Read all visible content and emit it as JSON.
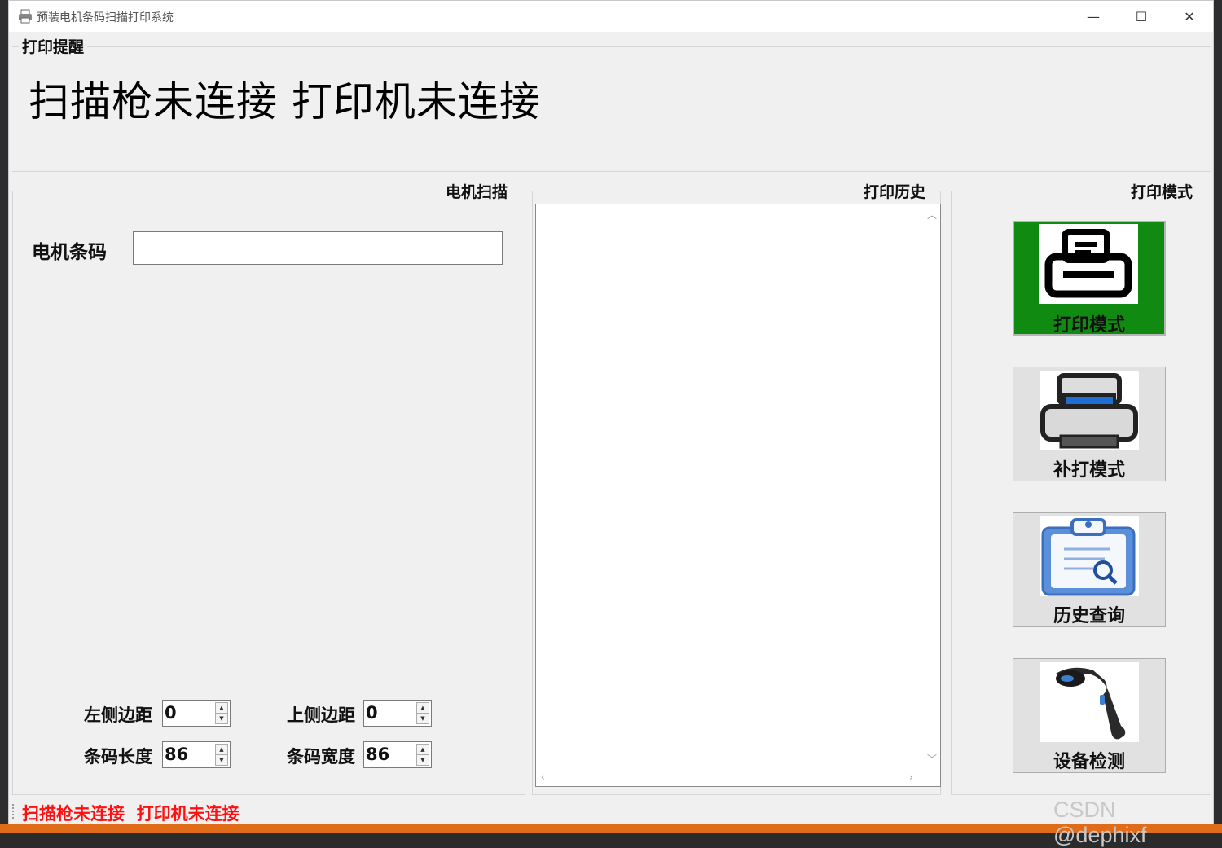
{
  "window": {
    "title": "预装电机条码扫描打印系统",
    "minimize_glyph": "—",
    "maximize_glyph": "☐",
    "close_glyph": "✕"
  },
  "alert": {
    "group_title": "打印提醒",
    "message": "扫描枪未连接 打印机未连接"
  },
  "scan": {
    "group_title": "电机扫描",
    "barcode_label": "电机条码",
    "barcode_value": "",
    "params": {
      "left_margin_label": "左侧边距",
      "left_margin_value": "0",
      "top_margin_label": "上侧边距",
      "top_margin_value": "0",
      "barcode_length_label": "条码长度",
      "barcode_length_value": "86",
      "barcode_width_label": "条码宽度",
      "barcode_width_value": "86"
    }
  },
  "history": {
    "group_title": "打印历史",
    "items": []
  },
  "mode": {
    "group_title": "打印模式",
    "buttons": [
      {
        "label": "打印模式",
        "icon": "printer-icon",
        "active": true
      },
      {
        "label": "补打模式",
        "icon": "reprint-printer-icon",
        "active": false
      },
      {
        "label": "历史查询",
        "icon": "clipboard-search-icon",
        "active": false
      },
      {
        "label": "设备检测",
        "icon": "barcode-scanner-icon",
        "active": false
      }
    ],
    "active_color": "#118a11"
  },
  "status_bar": {
    "text": "扫描枪未连接  打印机未连接",
    "color": "#ff1010"
  },
  "watermark": "CSDN @dephixf"
}
